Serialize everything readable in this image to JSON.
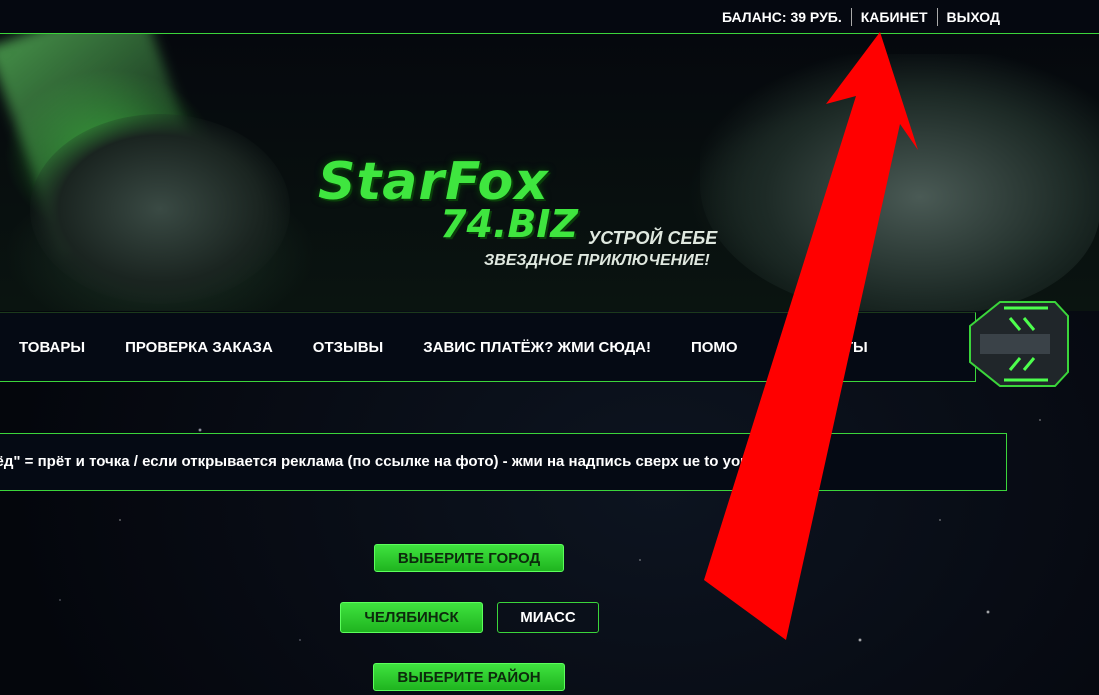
{
  "topbar": {
    "balance": "БАЛАНС: 39 РУБ.",
    "cabinet": "КАБИНЕТ",
    "logout": "ВЫХОД"
  },
  "banner": {
    "logo_main": "StarFox",
    "logo_domain": "74.BIZ",
    "tagline_line1": "УСТРОЙ СЕБЕ",
    "tagline_line2": "ЗВЕЗДНОЕ ПРИКЛЮЧЕНИЕ!"
  },
  "nav": {
    "items": [
      {
        "label": "ТОВАРЫ"
      },
      {
        "label": "ПРОВЕРКА ЗАКАЗА"
      },
      {
        "label": "ОТЗЫВЫ"
      },
      {
        "label": "ЗАВИС ПЛАТЁЖ? ЖМИ СЮДА!"
      },
      {
        "label": "ПОМО"
      },
      {
        "label": "КОНТАКТЫ"
      }
    ]
  },
  "notice": {
    "text": "лёд\" = прёт и точка / если открывается реклама (по ссылке на фото) - жми на надпись сверх          ue to your image\""
  },
  "city": {
    "title": "ВЫБЕРИТЕ ГОРОД",
    "options": [
      "ЧЕЛЯБИНСК",
      "МИАСС"
    ],
    "selected": "ЧЕЛЯБИНСК"
  },
  "district": {
    "title": "ВЫБЕРИТЕ РАЙОН"
  },
  "colors": {
    "accent_green": "#3bd53b",
    "background": "#04060c",
    "arrow_red": "#ff0000"
  }
}
